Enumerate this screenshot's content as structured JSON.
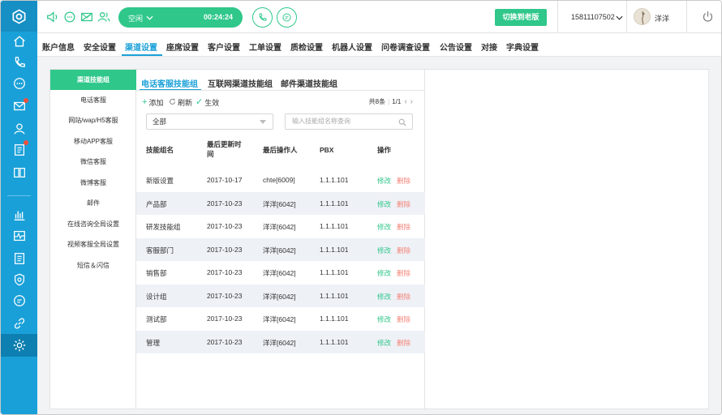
{
  "topbar": {
    "status": "空闲",
    "timer": "00:24:24",
    "switch_btn": "切换到老版",
    "phone_number": "15811107502",
    "user_name": "洋洋"
  },
  "nav": {
    "items": [
      "账户信息",
      "安全设置",
      "渠道设置",
      "座席设置",
      "客户设置",
      "工单设置",
      "质检设置",
      "机器人设置",
      "问卷调查设置",
      "公告设置",
      "对接",
      "字典设置"
    ],
    "active": "渠道设置"
  },
  "side_menu": {
    "items": [
      "渠道技能组",
      "电话客服",
      "网站/wap/H5客服",
      "移动APP客服",
      "微信客服",
      "微博客服",
      "邮件",
      "在线咨询全局设置",
      "视频客服全局设置",
      "短信＆闪信"
    ],
    "active": "渠道技能组"
  },
  "subtabs": {
    "items": [
      "电话客服技能组",
      "互联网渠道技能组",
      "邮件渠道技能组"
    ],
    "active": "电话客服技能组"
  },
  "actions": {
    "add": "添加",
    "refresh": "刷新",
    "apply": "生效"
  },
  "pager": {
    "total": "共8条",
    "page": "1/1"
  },
  "filter": {
    "selected": "全部",
    "search_placeholder": "输入技能组名称查询"
  },
  "table": {
    "headers": [
      "技能组名",
      "最后更新时间",
      "最后操作人",
      "PBX",
      "操作"
    ],
    "edit_label": "修改",
    "delete_label": "删除",
    "rows": [
      [
        "新版设置",
        "2017-10-17",
        "chte[6009]",
        "1.1.1.101"
      ],
      [
        "产品部",
        "2017-10-23",
        "洋洋[6042]",
        "1.1.1.101"
      ],
      [
        "研发技能组",
        "2017-10-23",
        "洋洋[6042]",
        "1.1.1.101"
      ],
      [
        "客服部门",
        "2017-10-23",
        "洋洋[6042]",
        "1.1.1.101"
      ],
      [
        "销售部",
        "2017-10-23",
        "洋洋[6042]",
        "1.1.1.101"
      ],
      [
        "设计组",
        "2017-10-23",
        "洋洋[6042]",
        "1.1.1.101"
      ],
      [
        "测试部",
        "2017-10-23",
        "洋洋[6042]",
        "1.1.1.101"
      ],
      [
        "管理",
        "2017-10-23",
        "洋洋[6042]",
        "1.1.1.101"
      ]
    ]
  },
  "colors": {
    "rail": "#1aa0d8",
    "accent": "#2fc78a",
    "link": "#1aa0d8",
    "danger": "#f5857a"
  }
}
